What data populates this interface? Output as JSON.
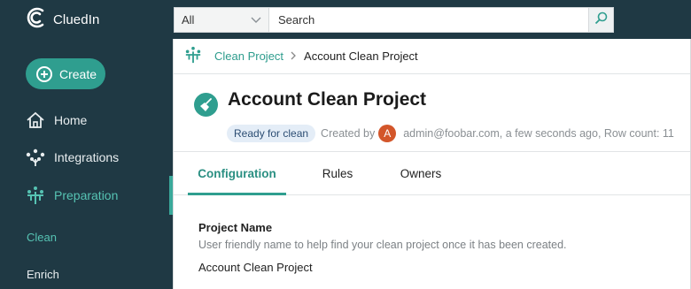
{
  "app": {
    "name": "CluedIn"
  },
  "search": {
    "scope": "All",
    "placeholder": "Search"
  },
  "sidebar": {
    "create_label": "Create",
    "items": [
      {
        "label": "Home",
        "icon": "home-icon"
      },
      {
        "label": "Integrations",
        "icon": "integrations-icon"
      },
      {
        "label": "Preparation",
        "icon": "preparation-icon",
        "active": true
      }
    ],
    "sub_items": [
      {
        "label": "Clean",
        "active": true
      },
      {
        "label": "Enrich",
        "active": false
      }
    ]
  },
  "breadcrumb": {
    "parent": "Clean Project",
    "current": "Account Clean Project"
  },
  "project": {
    "title": "Account Clean Project",
    "status": "Ready for clean",
    "created_by_label": "Created by",
    "avatar_letter": "A",
    "meta_text": "admin@foobar.com, a few seconds ago, Row count: 11"
  },
  "tabs": [
    {
      "label": "Configuration",
      "active": true
    },
    {
      "label": "Rules",
      "active": false
    },
    {
      "label": "Owners",
      "active": false
    }
  ],
  "config": {
    "field_label": "Project Name",
    "field_help": "User friendly name to help find your clean project once it has been created.",
    "field_value": "Account Clean Project"
  },
  "colors": {
    "sidebar_bg": "#1f3944",
    "accent": "#2f9e8f",
    "accent_text": "#56c3b3",
    "avatar": "#d3562a",
    "badge_bg": "#e4edf7"
  }
}
